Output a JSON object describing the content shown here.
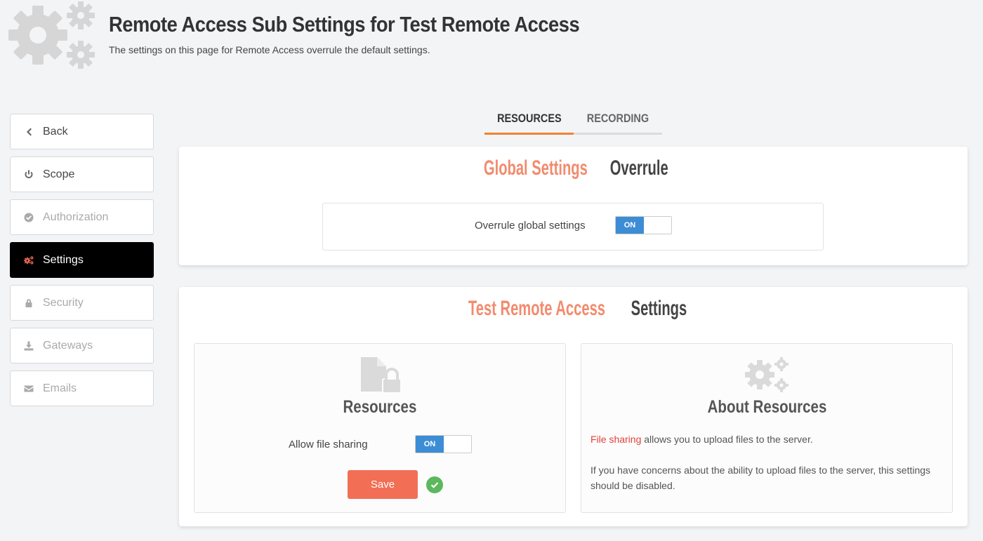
{
  "header": {
    "title": "Remote Access Sub Settings for Test Remote Access",
    "subtitle": "The settings on this page for Remote Access overrule the default settings."
  },
  "sidebar": {
    "items": [
      {
        "label": "Back",
        "icon": "chevron-left-icon",
        "state": "enabled"
      },
      {
        "label": "Scope",
        "icon": "power-icon",
        "state": "enabled"
      },
      {
        "label": "Authorization",
        "icon": "check-circle-icon",
        "state": "disabled"
      },
      {
        "label": "Settings",
        "icon": "gears-icon",
        "state": "active"
      },
      {
        "label": "Security",
        "icon": "lock-icon",
        "state": "disabled"
      },
      {
        "label": "Gateways",
        "icon": "download-icon",
        "state": "disabled"
      },
      {
        "label": "Emails",
        "icon": "envelope-icon",
        "state": "disabled"
      }
    ]
  },
  "tabs": [
    {
      "label": "RESOURCES",
      "active": true
    },
    {
      "label": "RECORDING",
      "active": false
    }
  ],
  "global_panel": {
    "title_accent": "Global Settings",
    "title_rest": "Overrule",
    "overrule_label": "Overrule global settings",
    "overrule_toggle": "ON"
  },
  "settings_panel": {
    "title_accent": "Test Remote Access",
    "title_rest": "Settings",
    "resources_card": {
      "title": "Resources",
      "file_sharing_label": "Allow file sharing",
      "file_sharing_toggle": "ON",
      "save_label": "Save"
    },
    "about_card": {
      "title": "About Resources",
      "highlight": "File sharing",
      "text1": " allows you to upload files to the server.",
      "text2": "If you have concerns about the ability to upload files to the server, this settings should be disabled."
    }
  },
  "colors": {
    "accent": "#f28b6e",
    "toggle_on": "#3c8dd5",
    "save_button": "#f26e55",
    "tab_active": "#f0822f",
    "success": "#5cb85c"
  }
}
